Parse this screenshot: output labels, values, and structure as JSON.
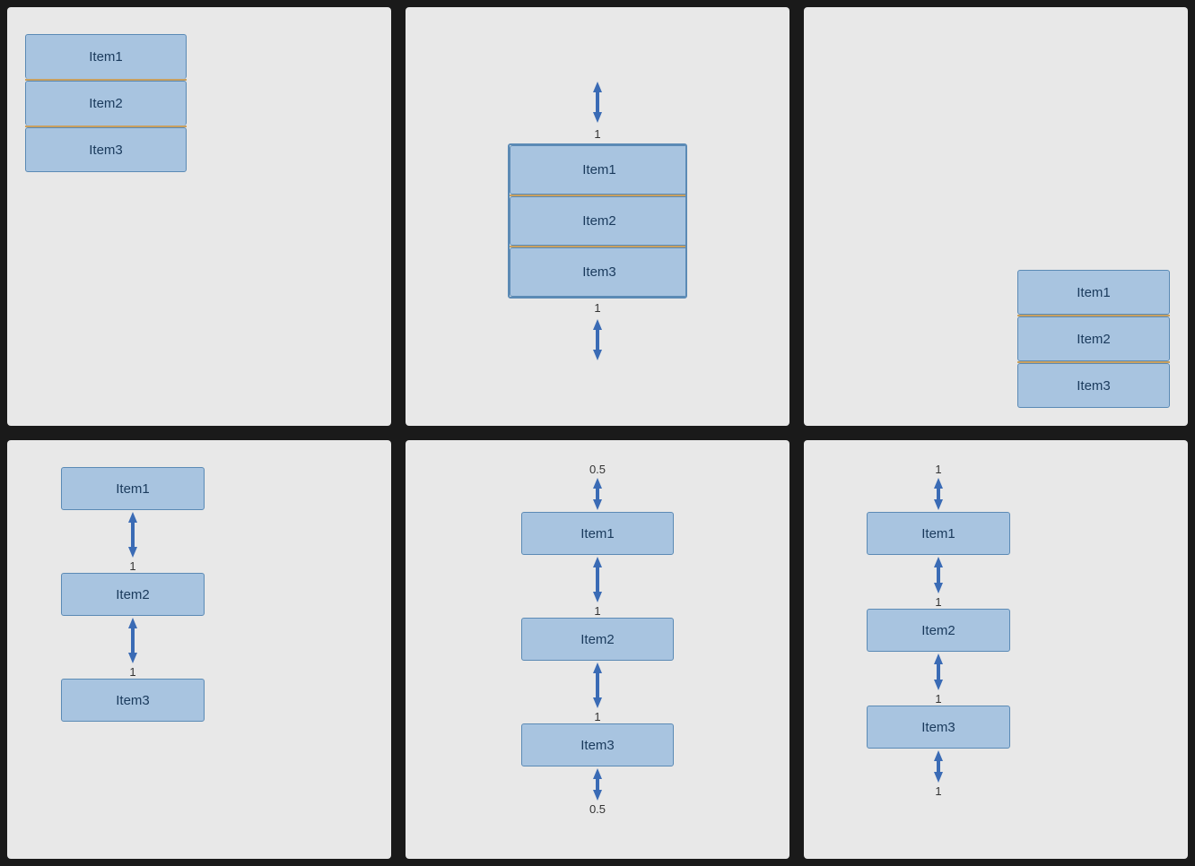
{
  "panels": [
    {
      "id": "panel-1",
      "items": [
        "Item1",
        "Item2",
        "Item3"
      ],
      "description": "Simple stacked list, top-left"
    },
    {
      "id": "panel-2",
      "items": [
        "Item1",
        "Item2",
        "Item3"
      ],
      "description": "Stacked list with bidirectional arrows top and bottom, label 1",
      "top_label": "1",
      "bottom_label": "1"
    },
    {
      "id": "panel-3",
      "items": [
        "Item1",
        "Item2",
        "Item3"
      ],
      "description": "List positioned bottom-right, no arrows"
    },
    {
      "id": "panel-4",
      "items": [
        "Item1",
        "Item2",
        "Item3"
      ],
      "description": "Vertical chain with arrows, labels 1",
      "labels": [
        "1",
        "1"
      ]
    },
    {
      "id": "panel-5",
      "items": [
        "Item1",
        "Item2",
        "Item3"
      ],
      "description": "Vertical chain with arrows, outer labels 0.5, inner labels 1",
      "labels": [
        "0.5",
        "1",
        "1",
        "0.5"
      ]
    },
    {
      "id": "panel-6",
      "items": [
        "Item1",
        "Item2",
        "Item3"
      ],
      "description": "Vertical chain with arrows, labels 1 including bottom tail",
      "labels": [
        "1",
        "1",
        "1",
        "1"
      ]
    }
  ]
}
